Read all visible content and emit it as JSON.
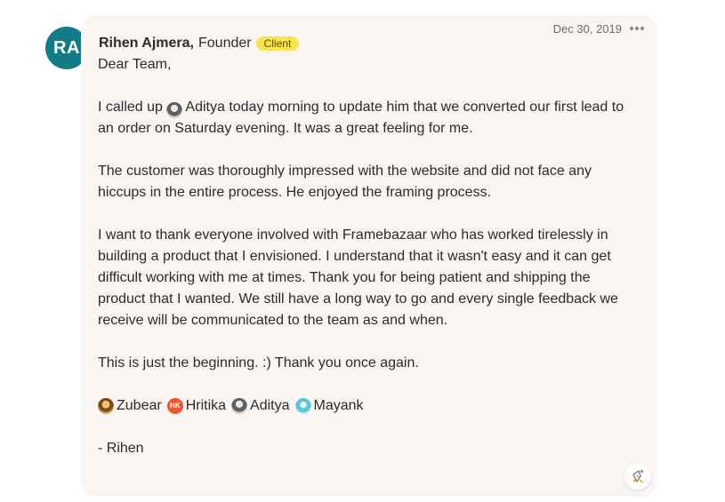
{
  "author": {
    "initials": "RA",
    "name": "Rihen Ajmera,",
    "role": "Founder",
    "badge": "Client",
    "avatar_color": "#137b86"
  },
  "post": {
    "date": "Dec 30, 2019",
    "more_icon": "more-horizontal-icon",
    "greeting": "Dear Team,",
    "p1_before": "I called up",
    "p1_mention": "Aditya",
    "p1_after": "today morning to update him that we converted our first lead to an order on Saturday evening. It was a great feeling for me.",
    "p2": "The customer was thoroughly impressed with the website and did not face any hiccups in the entire process. He enjoyed the framing process.",
    "p3": "I want to thank everyone involved with Framebazaar who has worked tirelessly in building a product that I envisioned. I understand that it wasn't easy and it can get difficult working with me at times. Thank you for being patient and shipping the product that I wanted. We still have a long way to go and every single feedback we receive will be communicated to the team as and when.",
    "p4": "This is just the beginning. :) Thank you once again.",
    "mentions": [
      {
        "name": "Zubear"
      },
      {
        "name": "Hritika",
        "initials": "HK"
      },
      {
        "name": "Aditya"
      },
      {
        "name": "Mayank"
      }
    ],
    "signature": "- Rihen",
    "reaction_icon": "add-reaction-icon"
  },
  "colors": {
    "card_background": "#f8f5f3",
    "badge_background": "#f9e44b",
    "text": "#2b2b2b",
    "muted": "#6d6d6d"
  }
}
